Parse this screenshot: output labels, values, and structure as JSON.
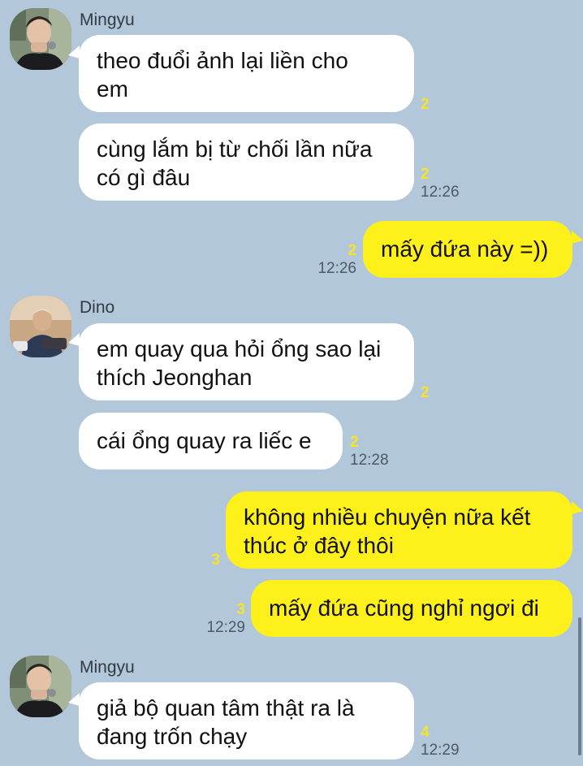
{
  "chat": {
    "groups": [
      {
        "sender": "Mingyu",
        "messages": [
          {
            "text": "theo đuổi ảnh lại liền cho\nem",
            "unread": "2",
            "time": ""
          },
          {
            "text": "cùng lắm bị từ chối lần nữa\ncó gì đâu",
            "unread": "2",
            "time": "12:26"
          }
        ]
      },
      {
        "sender": "me",
        "messages": [
          {
            "text": "mấy đứa này =))",
            "unread": "2",
            "time": "12:26"
          }
        ]
      },
      {
        "sender": "Dino",
        "messages": [
          {
            "text": "em quay qua hỏi ổng sao lại\nthích Jeonghan",
            "unread": "2",
            "time": ""
          },
          {
            "text": "cái ổng quay ra liếc e",
            "unread": "2",
            "time": "12:28"
          }
        ]
      },
      {
        "sender": "me",
        "messages": [
          {
            "text": "không nhiều chuyện nữa kết\nthúc ở đây thôi",
            "unread": "3",
            "time": ""
          },
          {
            "text": "mấy đứa cũng nghỉ ngơi đi",
            "unread": "3",
            "time": "12:29"
          }
        ]
      },
      {
        "sender": "Mingyu",
        "messages": [
          {
            "text": "giả bộ quan tâm thật ra là\nđang trốn chạy",
            "unread": "4",
            "time": "12:29"
          }
        ]
      }
    ]
  },
  "colors": {
    "background": "#b2c7da",
    "incoming_bubble": "#ffffff",
    "outgoing_bubble": "#fef01b",
    "unread_count": "#f5e42a"
  }
}
